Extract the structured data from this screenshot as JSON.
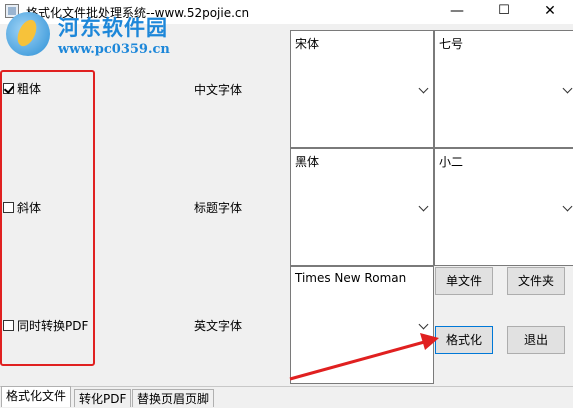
{
  "window": {
    "title": "格式化文件批处理系统--www.52pojie.cn",
    "minimize": "—",
    "maximize": "☐",
    "close": "✕"
  },
  "watermark": {
    "title": "河东软件园",
    "url": "www.pc0359.cn"
  },
  "options": {
    "bold": {
      "label": "粗体",
      "checked": true
    },
    "italic": {
      "label": "斜体",
      "checked": false
    },
    "convert_pdf": {
      "label": "同时转换PDF",
      "checked": false
    }
  },
  "rows": {
    "chinese": {
      "label": "中文字体",
      "font": "宋体",
      "size": "七号"
    },
    "heading": {
      "label": "标题字体",
      "font": "黑体",
      "size": "小二"
    },
    "english": {
      "label": "英文字体",
      "font": "Times New Roman"
    }
  },
  "buttons": {
    "single_file": "单文件",
    "folder": "文件夹",
    "format": "格式化",
    "exit": "退出"
  },
  "tabs": [
    {
      "label": "格式化文件",
      "active": true
    },
    {
      "label": "转化PDF",
      "active": false
    },
    {
      "label": "替换页眉页脚",
      "active": false
    }
  ],
  "colors": {
    "annotation_red": "#e02020",
    "watermark_blue": "#1d87d9",
    "focus_blue": "#0078d7"
  }
}
